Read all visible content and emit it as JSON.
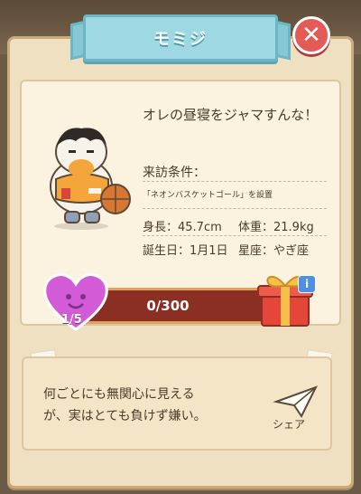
{
  "header": {
    "title": "モミジ",
    "close_icon": "close-icon"
  },
  "profile": {
    "quote": "オレの昼寝をジャマすんな！",
    "condition_label": "来訪条件：",
    "condition_text": "「ネオンバスケットゴール」を設置",
    "height": "身長：45.7cm",
    "weight": "体重：21.9kg",
    "birthday": "誕生日：1月1日",
    "constellation": "星座：やぎ座"
  },
  "friendship": {
    "level_text": "1/5",
    "progress_text": "0/300",
    "progress_fraction": 0
  },
  "reward": {
    "icon": "gift-box-icon",
    "info_label": "i"
  },
  "description": {
    "text_line1": "何ごとにも無関心に見える",
    "text_line2": "が、実はとても負けず嫌い。",
    "share_label": "シェア",
    "share_icon": "paper-plane-icon"
  },
  "colors": {
    "ribbon": "#9ed9e3",
    "close": "#e45a55",
    "bar_bg": "#8b2f25",
    "heart": "#d45bd8"
  }
}
